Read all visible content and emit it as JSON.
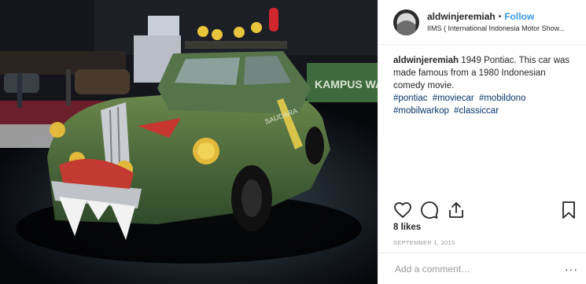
{
  "post": {
    "username": "aldwinjeremiah",
    "follow_label": "Follow",
    "location": "IIMS ( International Indonesia Motor Show...",
    "caption": {
      "username": "aldwinjeremiah",
      "text": "1949 Pontiac. This car was made famous from a 1980 Indonesian comedy movie.",
      "hashtags": [
        "#pontiac",
        "#moviecar",
        "#mobildono",
        "#mobilwarkop",
        "#classiccar"
      ]
    },
    "likes": "8 likes",
    "date": "SEPTEMBER 1, 2015",
    "comment_placeholder": "Add a comment…",
    "more_label": "···"
  },
  "photo": {
    "banner_text": "KAMPUS WA"
  },
  "icons": {
    "like": "heart-icon",
    "comment": "comment-icon",
    "share": "share-icon",
    "save": "bookmark-icon"
  }
}
